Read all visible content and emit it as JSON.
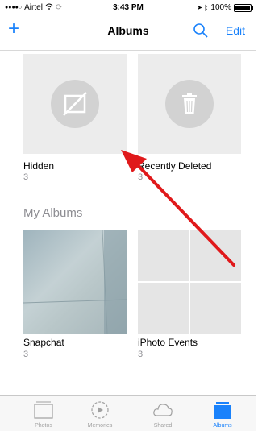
{
  "status_bar": {
    "carrier": "Airtel",
    "time": "3:43 PM",
    "battery": "100%"
  },
  "nav": {
    "title": "Albums",
    "edit_label": "Edit"
  },
  "albums_top": [
    {
      "name": "Hidden",
      "count": "3"
    },
    {
      "name": "Recently Deleted",
      "count": "3"
    }
  ],
  "section_title": "My Albums",
  "albums_mine": [
    {
      "name": "Snapchat",
      "count": "3"
    },
    {
      "name": "iPhoto Events",
      "count": "3"
    }
  ],
  "tabs": [
    {
      "label": "Photos"
    },
    {
      "label": "Memories"
    },
    {
      "label": "Shared"
    },
    {
      "label": "Albums"
    }
  ],
  "colors": {
    "accent": "#1a82fb",
    "annotation_arrow": "#e0191b"
  },
  "icons": [
    "plus-icon",
    "search-icon",
    "hidden-eye-slash-icon",
    "trash-icon",
    "photos-tab-icon",
    "memories-tab-icon",
    "shared-cloud-icon",
    "albums-tab-icon"
  ]
}
